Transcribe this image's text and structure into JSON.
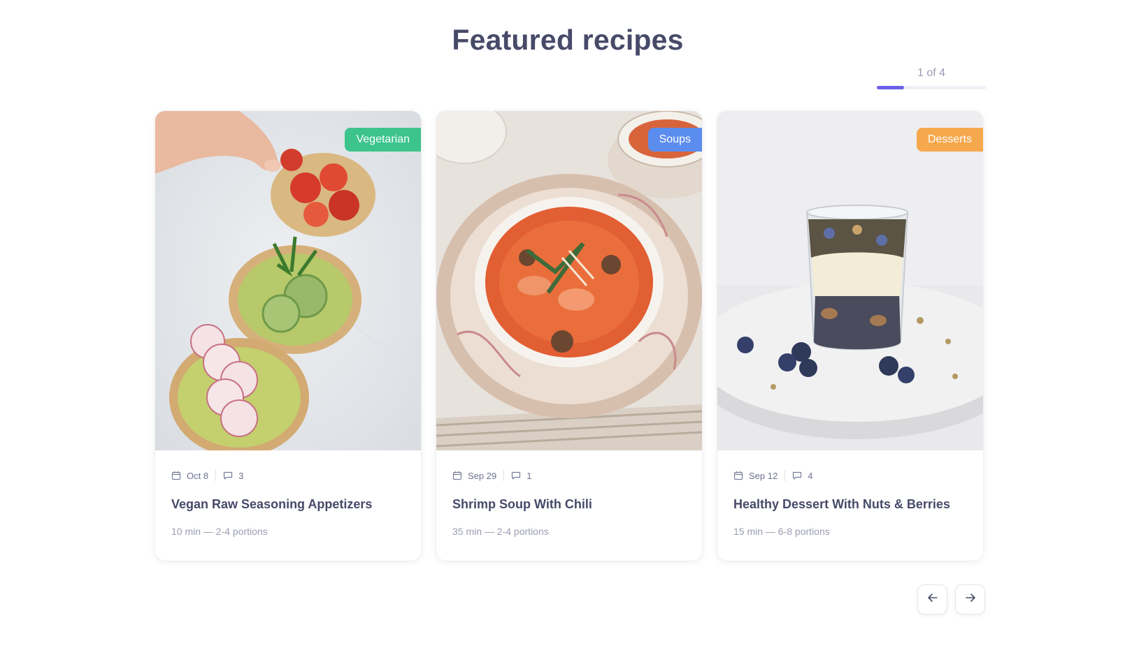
{
  "heading": "Featured recipes",
  "pager": {
    "label": "1 of 4",
    "progress": 0.25,
    "accent": "#6c60e8"
  },
  "cards": [
    {
      "category": "Vegetarian",
      "category_color": "#3cc48c",
      "date": "Oct 8",
      "comments": "3",
      "title": "Vegan Raw Seasoning Appetizers",
      "subtitle": "10 min — 2-4 portions",
      "image": "toasts-with-avocado-tomato-radish"
    },
    {
      "category": "Soups",
      "category_color": "#5b8def",
      "date": "Sep 29",
      "comments": "1",
      "title": "Shrimp Soup With Chili",
      "subtitle": "35 min — 2-4 portions",
      "image": "shrimp-soup-bowl"
    },
    {
      "category": "Desserts",
      "category_color": "#f6a84c",
      "date": "Sep 12",
      "comments": "4",
      "title": "Healthy Dessert With Nuts & Berries",
      "subtitle": "15 min — 6-8 portions",
      "image": "yogurt-parfait-glass"
    }
  ],
  "icons": {
    "date": "calendar-icon",
    "comments": "comment-icon",
    "prev": "arrow-left-icon",
    "next": "arrow-right-icon"
  }
}
